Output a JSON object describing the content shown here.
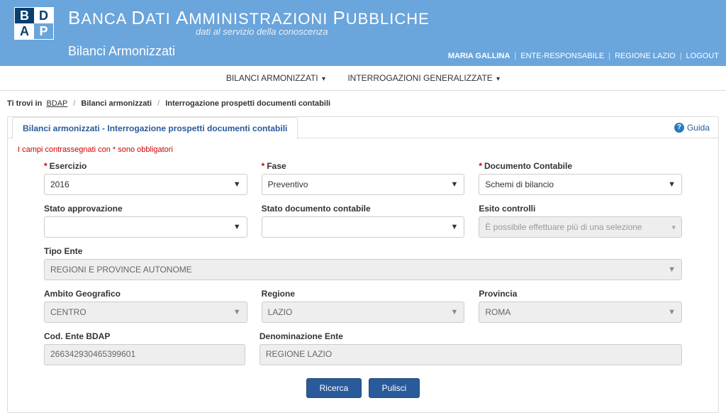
{
  "header": {
    "title_html": "BANCA DATI AMMINISTRAZIONI PUBBLICHE",
    "subtitle": "dati al servizio della conoscenza",
    "section": "Bilanci Armonizzati"
  },
  "user_bar": {
    "user": "MARIA GALLINA",
    "role": "ENTE-RESPONSABILE",
    "region": "REGIONE LAZIO",
    "logout": "LOGOUT"
  },
  "nav": {
    "item1": "BILANCI ARMONIZZATI",
    "item2": "INTERROGAZIONI GENERALIZZATE"
  },
  "breadcrumb": {
    "label": "Ti trovi in",
    "l1": "BDAP",
    "l2": "Bilanci armonizzati",
    "l3": "Interrogazione prospetti documenti contabili"
  },
  "panel": {
    "tab": "Bilanci armonizzati - Interrogazione prospetti documenti contabili",
    "help": "Guida",
    "required_note": "I campi contrassegnati con * sono obbligatori"
  },
  "form": {
    "esercizio_label": "Esercizio",
    "esercizio_value": "2016",
    "fase_label": "Fase",
    "fase_value": "Preventivo",
    "documento_label": "Documento Contabile",
    "documento_value": "Schemi di bilancio",
    "stato_approv_label": "Stato approvazione",
    "stato_approv_value": "",
    "stato_doc_label": "Stato documento contabile",
    "stato_doc_value": "",
    "esito_label": "Esito controlli",
    "esito_placeholder": "È possibile effettuare più di una selezione",
    "tipo_ente_label": "Tipo Ente",
    "tipo_ente_value": "REGIONI E PROVINCE AUTONOME",
    "ambito_label": "Ambito Geografico",
    "ambito_value": "CENTRO",
    "regione_label": "Regione",
    "regione_value": "LAZIO",
    "provincia_label": "Provincia",
    "provincia_value": "ROMA",
    "cod_ente_label": "Cod. Ente BDAP",
    "cod_ente_value": "266342930465399601",
    "denom_label": "Denominazione Ente",
    "denom_value": "REGIONE LAZIO"
  },
  "buttons": {
    "search": "Ricerca",
    "clear": "Pulisci"
  }
}
